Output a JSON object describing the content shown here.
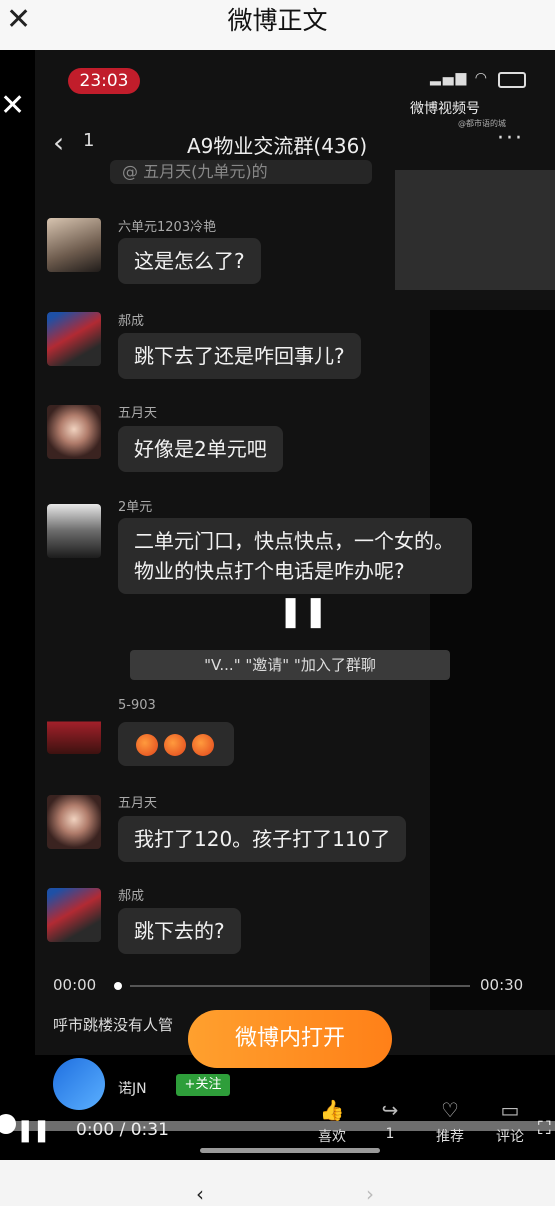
{
  "page": {
    "title": "微博正文"
  },
  "video": {
    "status_time": "23:03",
    "watermark": "微博视频号",
    "watermark_sub": "@都市语的城",
    "chat_title": "A9物业交流群(436)",
    "back_count": "1",
    "top_strip": "@ 五月天(九单元)的",
    "messages": [
      {
        "sender": "六单元1203冷艳",
        "text": "这是怎么了?"
      },
      {
        "sender": "郝成",
        "text": "跳下去了还是咋回事儿?"
      },
      {
        "sender": "五月天",
        "text": "好像是2单元吧"
      },
      {
        "sender": "2单元",
        "text": "二单元门口，快点快点，一个女的。物业的快点打个电话是咋办呢?"
      },
      {
        "sender": "5-903",
        "text": ""
      },
      {
        "sender": "五月天",
        "text": "我打了120。孩子打了110了"
      },
      {
        "sender": "郝成",
        "text": "跳下去的?"
      }
    ],
    "system_msg": "\"V...\" \"邀请\" \"加入了群聊",
    "current_time": "00:00",
    "total_time": "00:30",
    "caption": "呼市跳楼没有人管"
  },
  "open_button": "微博内打开",
  "poster": {
    "name": "诺JN",
    "follow": "+关注"
  },
  "actions": {
    "like": "喜欢",
    "forward": "1",
    "recommend": "推荐",
    "comment": "评论"
  },
  "player": {
    "time": "0:00 / 0:31",
    "progress": 0.0
  },
  "colors": {
    "accent": "#ff8a1f",
    "follow": "#2e9e3a",
    "status_red": "#c11d2b"
  }
}
